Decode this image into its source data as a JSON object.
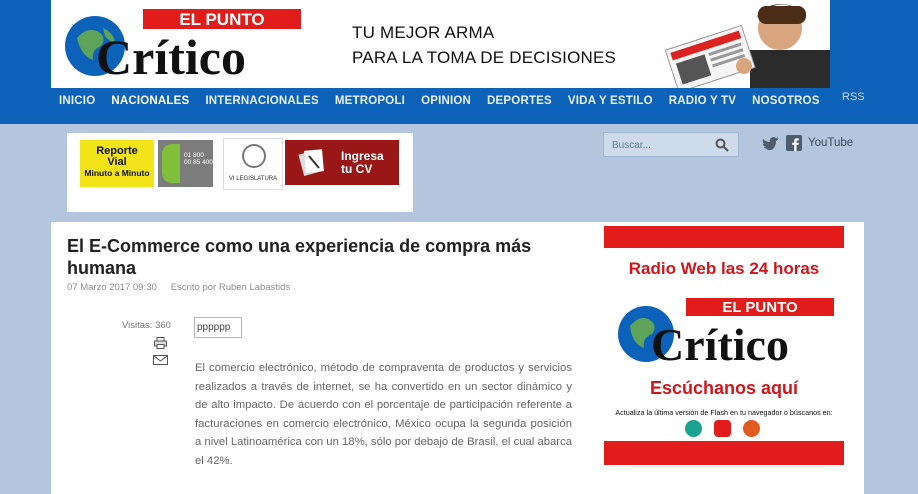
{
  "brand": {
    "logo_top": "EL PUNTO",
    "logo_bottom": "Crítico",
    "tagline_line1": "TU MEJOR ARMA",
    "tagline_line2": "PARA LA TOMA DE DECISIONES",
    "primary_color": "#0b62b8",
    "accent_red": "#e21b1b"
  },
  "nav": {
    "items": [
      "INICIO",
      "NACIONALES",
      "INTERNACIONALES",
      "METROPOLI",
      "OPINION",
      "DEPORTES",
      "VIDA Y ESTILO",
      "RADIO Y TV",
      "NOSOTROS"
    ],
    "active": "NACIONALES",
    "rss": "RSS"
  },
  "banners": {
    "vial_line1": "Reporte",
    "vial_line2": "Vial",
    "vial_line3": "Minuto a Minuto",
    "phone_prefix": "01 800",
    "phone_number": "00 85 400",
    "legislatura": "VI LEGISLATURA",
    "cv_line1": "Ingresa",
    "cv_line2": "tu CV"
  },
  "search": {
    "placeholder": "Buscar..."
  },
  "social": {
    "youtube": "YouTube"
  },
  "article": {
    "title": "El E-Commerce como una experiencia de compra más humana",
    "date": "07 Marzo 2017 09:30",
    "author": "Escrito por Ruben Labastids",
    "visits": "Visitas: 360",
    "image_alt": "pppppp",
    "body": "El comercio electrónico, método de compraventa de productos y servicios realizados a través de internet, se ha convertido en un sector dinámico y de alto impacto. De acuerdo con el porcentaje de participación referente a facturaciones en comercio electrónico, México ocupa la segunda posición a nivel Latinoamérica con un 18%, sólo por debajo de Brasil, el cual abarca el 42%."
  },
  "radio": {
    "heading": "Radio Web las 24 horas",
    "logo_top": "EL PUNTO",
    "logo_bottom": "Crítico",
    "listen": "Escúchanos aquí",
    "note": "Actualiza la última versión de Flash en tu navegador o búscanos en:"
  }
}
